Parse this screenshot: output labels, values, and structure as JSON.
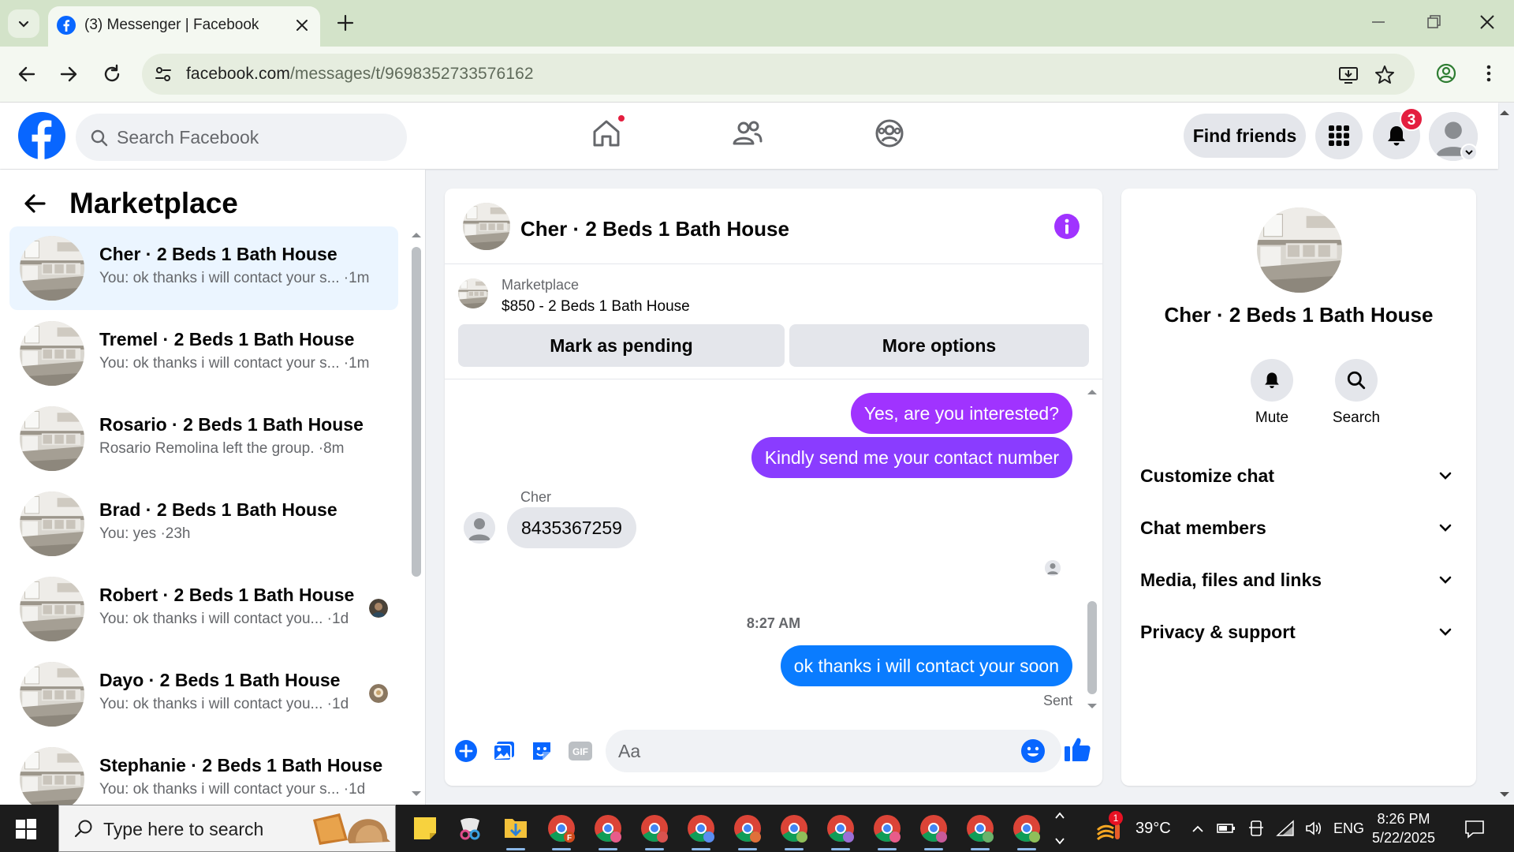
{
  "browser": {
    "tab_title": "(3) Messenger | Facebook",
    "url_domain": "facebook.com",
    "url_path": "/messages/t/9698352733576162"
  },
  "header": {
    "search_placeholder": "Search Facebook",
    "find_friends_label": "Find friends",
    "notification_count": "3"
  },
  "left_panel": {
    "title": "Marketplace",
    "chats": [
      {
        "name": "Cher · 2 Beds 1 Bath House",
        "snippet": "You: ok thanks i will contact your s... ·1m",
        "active": true
      },
      {
        "name": "Tremel · 2 Beds 1 Bath House",
        "snippet": "You: ok thanks i will contact your s... ·1m"
      },
      {
        "name": "Rosario · 2 Beds 1 Bath House",
        "snippet": "Rosario Remolina left the group. ·8m"
      },
      {
        "name": "Brad · 2 Beds 1 Bath House",
        "snippet": "You: yes ·23h"
      },
      {
        "name": "Robert · 2 Beds 1 Bath House",
        "snippet": "You: ok thanks i will contact you... ·1d"
      },
      {
        "name": "Dayo · 2 Beds 1 Bath House",
        "snippet": "You: ok thanks i will contact you... ·1d"
      },
      {
        "name": "Stephanie · 2 Beds 1 Bath House",
        "snippet": "You: ok thanks i will contact your s... ·1d"
      }
    ]
  },
  "conversation": {
    "title": "Cher · 2 Beds 1 Bath House",
    "marketplace_label": "Marketplace",
    "listing": "$850 - 2 Beds 1 Bath House",
    "mark_pending_label": "Mark as pending",
    "more_options_label": "More options",
    "messages": {
      "out_1": "Yes, are you interested?",
      "out_2": "Kindly send me your contact number",
      "sender": "Cher",
      "in_1": "8435367259",
      "time": "8:27 AM",
      "out_3": "ok thanks i will contact your soon",
      "status": "Sent"
    },
    "composer_placeholder": "Aa"
  },
  "details_panel": {
    "name": "Cher · 2 Beds 1 Bath House",
    "mute_label": "Mute",
    "search_label": "Search",
    "sections": [
      "Customize chat",
      "Chat members",
      "Media, files and links",
      "Privacy & support"
    ]
  },
  "taskbar": {
    "search_placeholder": "Type here to search",
    "weather": "39°C",
    "language": "ENG",
    "time": "8:26 PM",
    "date": "5/22/2025",
    "weather_badge": "1"
  },
  "colors": {
    "fb_blue": "#0866ff",
    "bubble_purple": "#a033ff",
    "bubble_blue": "#0a7cff",
    "info_purple": "#a033ff",
    "notif_red": "#e41e3f"
  }
}
